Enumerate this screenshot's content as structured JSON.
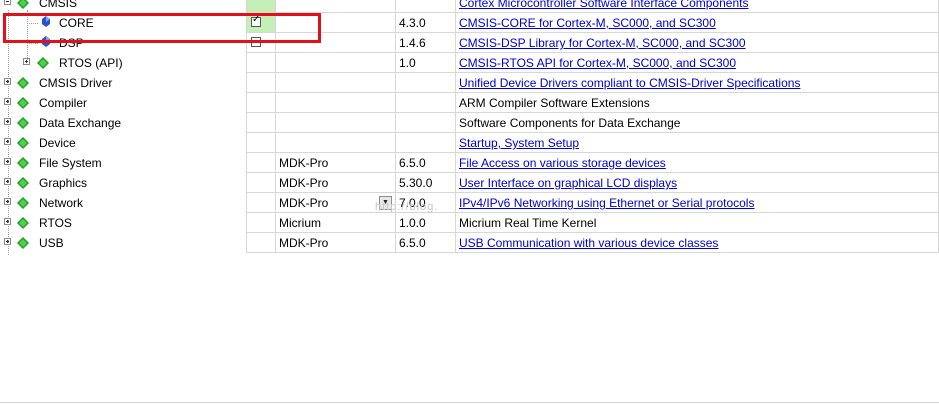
{
  "rows": [
    {
      "name": "CMSIS",
      "selected": "",
      "variant": "",
      "version": "",
      "description": "Cortex Microcontroller Software Interface Components",
      "desc_link": true
    },
    {
      "name": "CORE",
      "selected": "checked",
      "variant": "",
      "version": "4.3.0",
      "description": "CMSIS-CORE for Cortex-M, SC000, and SC300",
      "desc_link": true
    },
    {
      "name": "DSP",
      "selected": "unchecked",
      "variant": "",
      "version": "1.4.6",
      "description": "CMSIS-DSP Library for Cortex-M, SC000, and SC300",
      "desc_link": true
    },
    {
      "name": "RTOS (API)",
      "selected": "",
      "variant": "",
      "version": "1.0",
      "description": "CMSIS-RTOS API for Cortex-M, SC000, and SC300",
      "desc_link": true
    },
    {
      "name": "CMSIS Driver",
      "selected": "",
      "variant": "",
      "version": "",
      "description": "Unified Device Drivers compliant to CMSIS-Driver Specifications",
      "desc_link": true
    },
    {
      "name": "Compiler",
      "selected": "",
      "variant": "",
      "version": "",
      "description": "ARM Compiler Software Extensions",
      "desc_link": false
    },
    {
      "name": "Data Exchange",
      "selected": "",
      "variant": "",
      "version": "",
      "description": "Software Components for Data Exchange",
      "desc_link": false
    },
    {
      "name": "Device",
      "selected": "",
      "variant": "",
      "version": "",
      "description": "Startup, System Setup",
      "desc_link": true
    },
    {
      "name": "File System",
      "selected": "",
      "variant": "MDK-Pro",
      "version": "6.5.0",
      "description": "File Access on various storage devices",
      "desc_link": true
    },
    {
      "name": "Graphics",
      "selected": "",
      "variant": "MDK-Pro",
      "version": "5.30.0",
      "description": "User Interface on graphical LCD displays",
      "desc_link": true
    },
    {
      "name": "Network",
      "selected": "",
      "variant": "MDK-Pro",
      "version": "7.0.0",
      "description": "IPv4/IPv6 Networking using Ethernet or Serial protocols",
      "desc_link": true
    },
    {
      "name": "RTOS",
      "selected": "",
      "variant": "Micrium",
      "version": "1.0.0",
      "description": "Micrium Real Time Kernel",
      "desc_link": false
    },
    {
      "name": "USB",
      "selected": "",
      "variant": "MDK-Pro",
      "version": "6.5.0",
      "description": "USB Communication with various device classes",
      "desc_link": true
    }
  ],
  "network_variant_dropdown_icon": "chevron-down-icon",
  "watermark_text": "http://blog.",
  "colors": {
    "highlight_red": "#e0111b",
    "link_blue": "#0000cc",
    "selected_green": "#c4f0b8",
    "diamond_green": "#1fa020"
  }
}
